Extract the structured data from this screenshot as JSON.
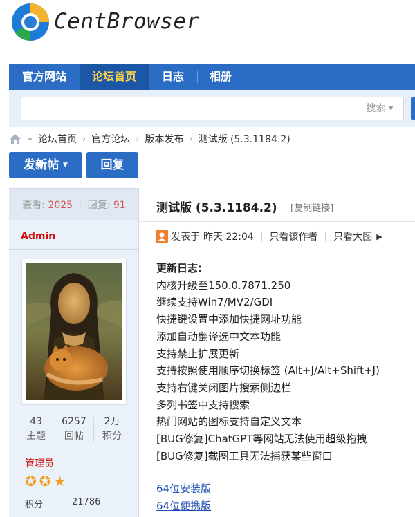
{
  "logo": {
    "text": "CentBrowser"
  },
  "nav": {
    "items": [
      "官方网站",
      "论坛首页",
      "日志",
      "相册"
    ],
    "active_index": 1
  },
  "search": {
    "placeholder": "",
    "button_label": "搜索"
  },
  "breadcrumb": [
    "论坛首页",
    "官方论坛",
    "版本发布",
    "测试版 (5.3.1184.2)"
  ],
  "actions": {
    "post_label": "发新帖",
    "reply_label": "回复"
  },
  "thread_stats": {
    "views_label": "查看:",
    "views": "2025",
    "replies_label": "回复:",
    "replies": "91"
  },
  "thread": {
    "title": "测试版 (5.3.1184.2)",
    "copy_link": "[复制链接]"
  },
  "author": {
    "name": "Admin",
    "stats": [
      {
        "value": "43",
        "label": "主题"
      },
      {
        "value": "6257",
        "label": "回帖"
      },
      {
        "value": "2万",
        "label": "积分"
      }
    ],
    "group": "管理员",
    "stars_count": 3,
    "credits_label": "积分",
    "credits_value": "21786"
  },
  "post_meta": {
    "posted_label": "发表于",
    "posted_time": "昨天 22:04",
    "only_author": "只看该作者",
    "large_image": "只看大图"
  },
  "changelog": {
    "heading": "更新日志:",
    "lines": [
      "内核升级至150.0.7871.250",
      "继续支持Win7/MV2/GDI",
      "快捷键设置中添加快捷网址功能",
      "添加自动翻译选中文本功能",
      "支持禁止扩展更新",
      "支持按照使用顺序切换标签 (Alt+J/Alt+Shift+J)",
      "支持右键关闭图片搜索侧边栏",
      "多列书签中支持搜索",
      "热门网站的图标支持自定义文本",
      "[BUG修复]ChatGPT等网站无法使用超级拖拽",
      "[BUG修复]截图工具无法捕获某些窗口"
    ]
  },
  "downloads": [
    "64位安装版",
    "64位便携版"
  ],
  "colors": {
    "nav_bg": "#2b6cc4",
    "nav_active_bg": "#1c57a5",
    "nav_active_text": "#ffd24a",
    "link": "#1f4fb0",
    "author_red": "#d01010"
  },
  "icons": [
    "centbrowser-logo-icon",
    "home-icon",
    "chevron-down-icon",
    "user-icon",
    "triangle-right-icon",
    "star-icon"
  ]
}
